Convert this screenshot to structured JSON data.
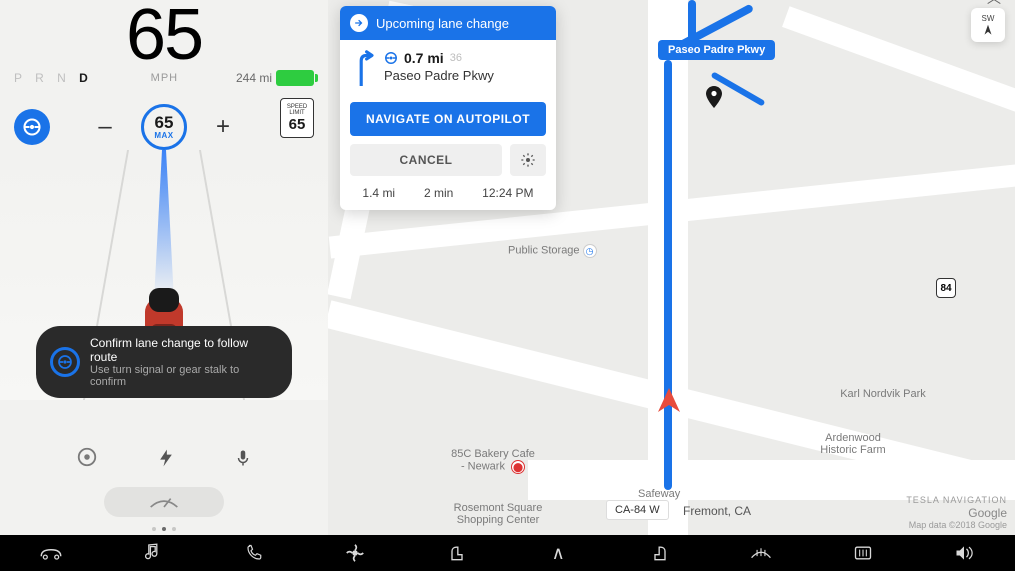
{
  "cluster": {
    "speed": "65",
    "speed_unit": "MPH",
    "gears": [
      "P",
      "R",
      "N",
      "D"
    ],
    "selected_gear": "D",
    "range": "244 mi",
    "set_speed": "65",
    "set_speed_label": "MAX",
    "speed_limit_label": "SPEED LIMIT",
    "speed_limit": "65",
    "toast_title": "Confirm lane change to follow route",
    "toast_sub": "Use turn signal or gear stalk to confirm"
  },
  "nav": {
    "banner": "Upcoming lane change",
    "distance": "0.7 mi",
    "exit": "36",
    "road": "Paseo Padre Pkwy",
    "primary_btn": "NAVIGATE ON AUTOPILOT",
    "cancel": "CANCEL",
    "meta_dist": "1.4 mi",
    "meta_time": "2 min",
    "meta_eta": "12:24 PM"
  },
  "compass": "SW",
  "map": {
    "pill_road": "Paseo Padre Pkwy",
    "highway_shield": "84",
    "highway_label": "CA-84 W",
    "city": "Fremont, CA",
    "poi_storage": "Public Storage",
    "poi_bakery": "85C Bakery Cafe - Newark",
    "poi_rosemont": "Rosemont Square Shopping Center",
    "poi_ardenwood": "Ardenwood Historic Farm",
    "poi_karl": "Karl Nordvik Park",
    "poi_safeway": "Safeway",
    "attrib_brand": "TESLA NAVIGATION",
    "attrib_google": "Google",
    "attrib_legal": "Map data ©2018 Google"
  }
}
